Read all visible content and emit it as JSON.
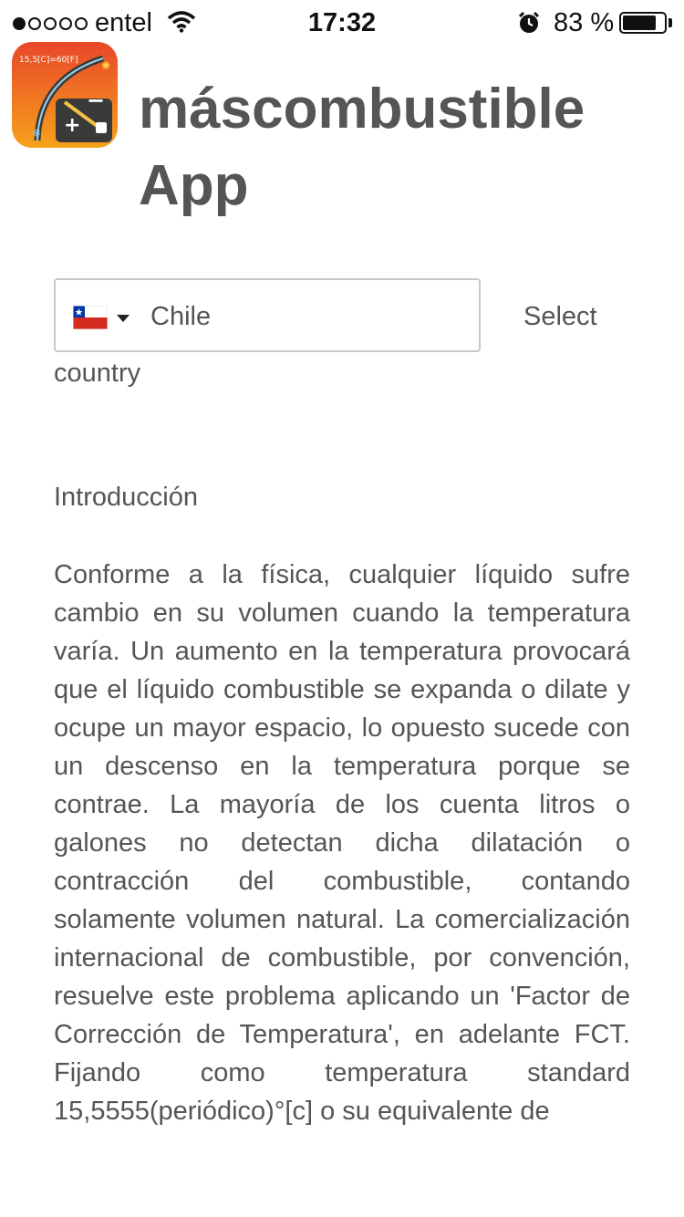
{
  "status_bar": {
    "carrier": "entel",
    "time": "17:32",
    "battery_percent": "83 %",
    "battery_level": 0.83,
    "signal_bars_filled": 1,
    "signal_bars_total": 5,
    "icons": [
      "wifi-icon",
      "alarm-icon",
      "battery-icon"
    ]
  },
  "header": {
    "title_line1": "máscombustible",
    "title_line2": "App",
    "logo_text": "15,5[C]=60[F]"
  },
  "country_selector": {
    "value": "Chile",
    "flag": "chile-flag-icon",
    "select_label": "Select",
    "label_continuation": "country"
  },
  "content": {
    "heading": "Introducción",
    "body": "Conforme a la física, cualquier líquido sufre cambio en su volumen cuando la temperatura varía. Un aumento en la temperatura provocará que el líquido combustible se expanda o dilate y ocupe un mayor espacio, lo opuesto sucede con un descenso en la temperatura porque se contrae. La mayoría de los cuenta litros o galones no detectan dicha dilatación o contracción del combustible, contando solamente volumen natural. La comercialización internacional de combustible, por convención, resuelve este problema aplicando un 'Factor de Corrección de Temperatura', en adelante FCT. Fijando como temperatura standard 15,5555(periódico)°[c] o su equivalente de"
  },
  "colors": {
    "text": "#555555",
    "border": "#c8c8c8",
    "logo_gradient_top": "#e8472a",
    "logo_gradient_bottom": "#f7a21b"
  }
}
